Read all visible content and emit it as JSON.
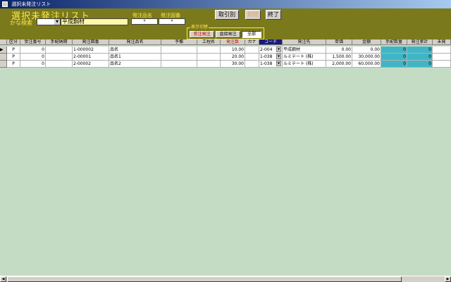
{
  "window": {
    "title": "選択未発注リスト"
  },
  "header": {
    "title": "選択未発注リスト",
    "kana_label": "かな検索",
    "customer_value": "平成鋼材",
    "order_name_label": "発注品名",
    "order_drawing_label": "発注図番",
    "order_name_value": "*",
    "order_drawing_value": "*"
  },
  "buttons": {
    "by_customer": "取引別",
    "delete": "削除",
    "exit": "終了"
  },
  "toggle": {
    "legend": "表示切替",
    "options": [
      "受注発注",
      "直接発注",
      "全部"
    ]
  },
  "table": {
    "columns": [
      "区分",
      "受注番号",
      "手配納期",
      "発注図番",
      "発注品名",
      "予備",
      "工程名",
      "発注数",
      "カナ",
      "コード",
      "発注先",
      "単価",
      "金額",
      "手配数量",
      "発注累計",
      "未発"
    ],
    "rows": [
      [
        "P",
        "0",
        "",
        "1-000002",
        "品名",
        "",
        "",
        "10.00",
        "",
        "2-004",
        "平成鋼材",
        "0.00",
        "0.00",
        "0",
        "0",
        ""
      ],
      [
        "P",
        "0",
        "",
        "2-00001",
        "品名1",
        "",
        "",
        "20.00",
        "",
        "1-038",
        "ルミテート (株)",
        "1,500.00",
        "30,000.00",
        "0",
        "0",
        ""
      ],
      [
        "P",
        "0",
        "",
        "2-00002",
        "品名2",
        "",
        "",
        "30.00",
        "",
        "1-038",
        "ルミテート (株)",
        "2,000.00",
        "60,000.00",
        "0",
        "0",
        ""
      ]
    ]
  },
  "colors": {
    "header_bg": "#7a7a1c",
    "title_yellow": "#ffe84a",
    "body_bg": "#c4dcc4",
    "qty_cell": "#3fb6c6",
    "code_header": "#1a1a7a"
  },
  "icons": {
    "row_pointer": "triangle-right-icon",
    "scroll_left": "arrow-left-icon",
    "scroll_right": "arrow-right-icon"
  }
}
